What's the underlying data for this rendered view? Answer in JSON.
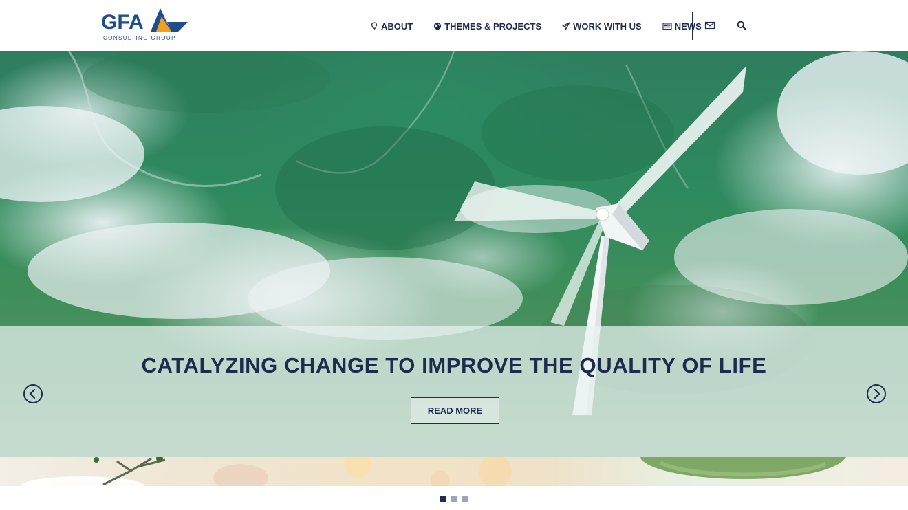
{
  "brand": {
    "logo_letters": "GFA",
    "logo_subtitle": "CONSULTING GROUP",
    "primary_color": "#1f4e8c",
    "accent_color": "#f0a020"
  },
  "nav": {
    "items": [
      {
        "label": "ABOUT",
        "icon": "lightbulb-icon"
      },
      {
        "label": "THEMES & PROJECTS",
        "icon": "globe-icon"
      },
      {
        "label": "WORK WITH US",
        "icon": "paper-plane-icon"
      },
      {
        "label": "NEWS",
        "icon": "newspaper-icon"
      }
    ],
    "utility_icons": [
      "envelope-icon",
      "search-icon"
    ]
  },
  "hero": {
    "title": "CATALYZING CHANGE TO IMPROVE THE QUALITY OF LIFE",
    "button_label": "READ MORE",
    "prev_icon": "chevron-left-circle-icon",
    "next_icon": "chevron-right-circle-icon"
  },
  "carousel": {
    "slide_count": 3,
    "active_index": 0,
    "active_color": "#1d2b4f",
    "inactive_color": "#9aa7b8"
  }
}
